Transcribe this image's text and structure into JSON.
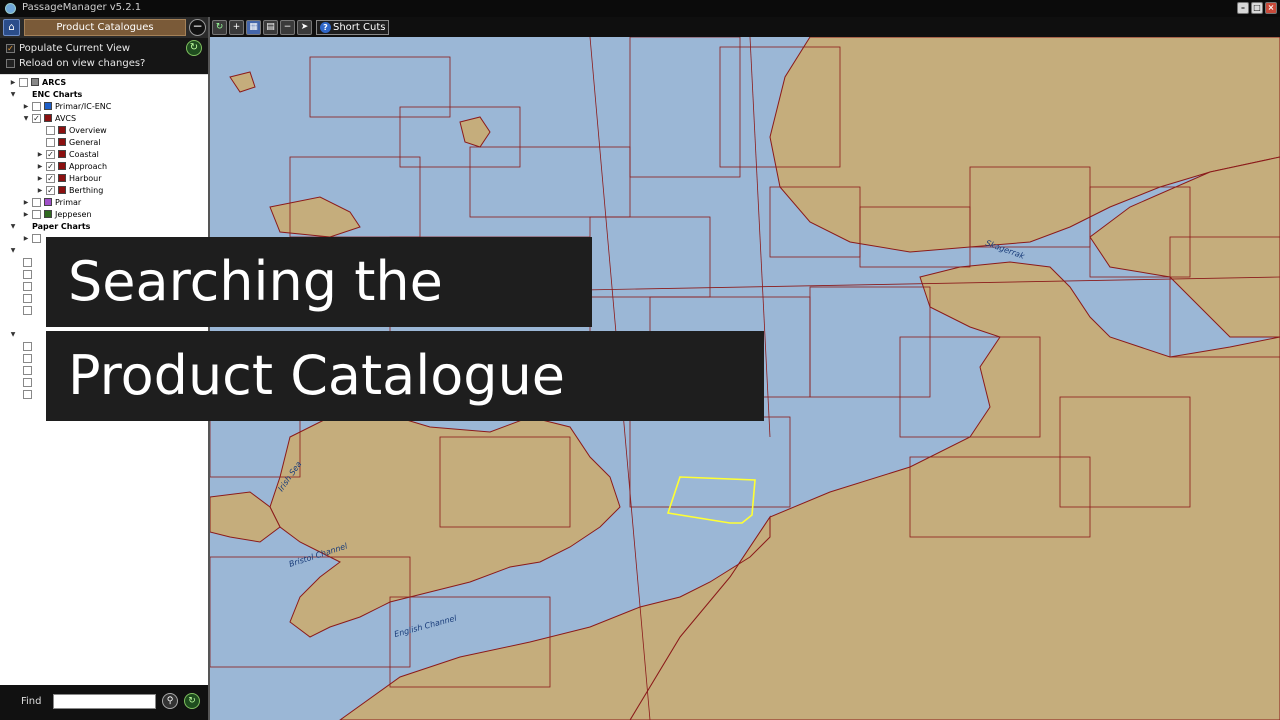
{
  "window": {
    "title": "PassageManager v5.2.1"
  },
  "panel": {
    "title": "Product Catalogues",
    "populate_label": "Populate Current View",
    "reload_label": "Reload on view changes?"
  },
  "tree": {
    "arcs": "ARCS",
    "enc_charts": "ENC Charts",
    "primar_ic_enc": "Primar/IC-ENC",
    "avcs": "AVCS",
    "overview": "Overview",
    "general": "General",
    "coastal": "Coastal",
    "approach": "Approach",
    "harbour": "Harbour",
    "berthing": "Berthing",
    "primar": "Primar",
    "jeppesen": "Jeppesen",
    "paper_charts": "Paper Charts"
  },
  "find": {
    "label": "Find",
    "value": ""
  },
  "toolbar": {
    "shortcuts_label": "Short Cuts"
  },
  "overlay": {
    "line1": "Searching the",
    "line2": "Product Catalogue"
  },
  "map_labels": {
    "skagerrak": "Skagerrak",
    "irish_sea": "Irish Sea",
    "bristol_channel": "Bristol Channel",
    "english_channel": "English Channel"
  },
  "colors": {
    "sea": "#9bb7d6",
    "land": "#c5ad7c",
    "chart_border": "#8b1a1a",
    "selection": "#ffff33",
    "avcs_swatch": "#8b1010",
    "primar_ic_enc_swatch": "#1e5fc8",
    "primar_swatch": "#a050c8",
    "jeppesen_swatch": "#2f6a1f",
    "arcs_swatch": "#888888"
  }
}
